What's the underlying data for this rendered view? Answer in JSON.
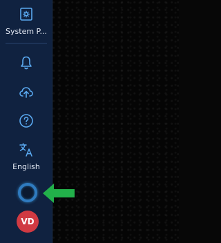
{
  "sidebar": {
    "system_settings": {
      "label": "System P...",
      "icon": "settings-gear-icon"
    },
    "notifications": {
      "icon": "bell-icon"
    },
    "cloud_upload": {
      "icon": "cloud-upload-icon"
    },
    "help": {
      "icon": "help-icon"
    },
    "language": {
      "label": "English",
      "icon": "translate-icon"
    },
    "loading": {
      "icon": "loading-spinner-icon"
    },
    "user": {
      "initials": "VD"
    }
  },
  "colors": {
    "sidebar_bg": "#102240",
    "icon": "#5aa9f0",
    "avatar": "#d03a42",
    "annotation_arrow": "#22b04a",
    "canvas": "#050505"
  },
  "annotation": {
    "arrow_direction": "left"
  }
}
